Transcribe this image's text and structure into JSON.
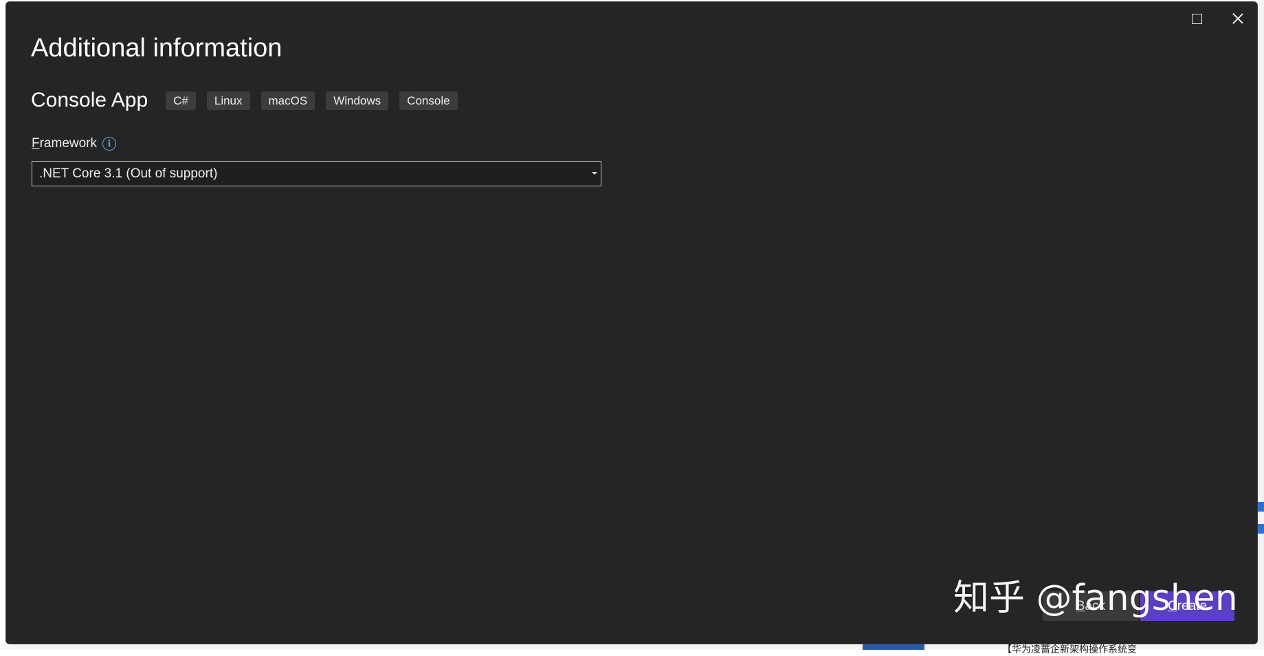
{
  "dialog": {
    "title": "Additional information",
    "window_controls": {
      "maximize_icon": "maximize-icon",
      "close_icon": "close-icon"
    }
  },
  "project": {
    "name": "Console App",
    "tags": [
      "C#",
      "Linux",
      "macOS",
      "Windows",
      "Console"
    ]
  },
  "framework": {
    "label_access_key": "F",
    "label_rest": "ramework",
    "info_icon": "info-icon",
    "selected": ".NET Core 3.1 (Out of support)"
  },
  "buttons": {
    "back_access_key": "B",
    "back_rest": "ack",
    "create_access_key": "C",
    "create_rest": "reate"
  },
  "watermark": "知乎 @fangshen",
  "background_page": {
    "bottom_text": "【华为凌蔷企新架构操作系统变"
  },
  "colors": {
    "dialog_bg": "#252525",
    "tag_bg": "#3c3c3c",
    "accent": "#5b40c4",
    "info": "#5aa7e6"
  }
}
